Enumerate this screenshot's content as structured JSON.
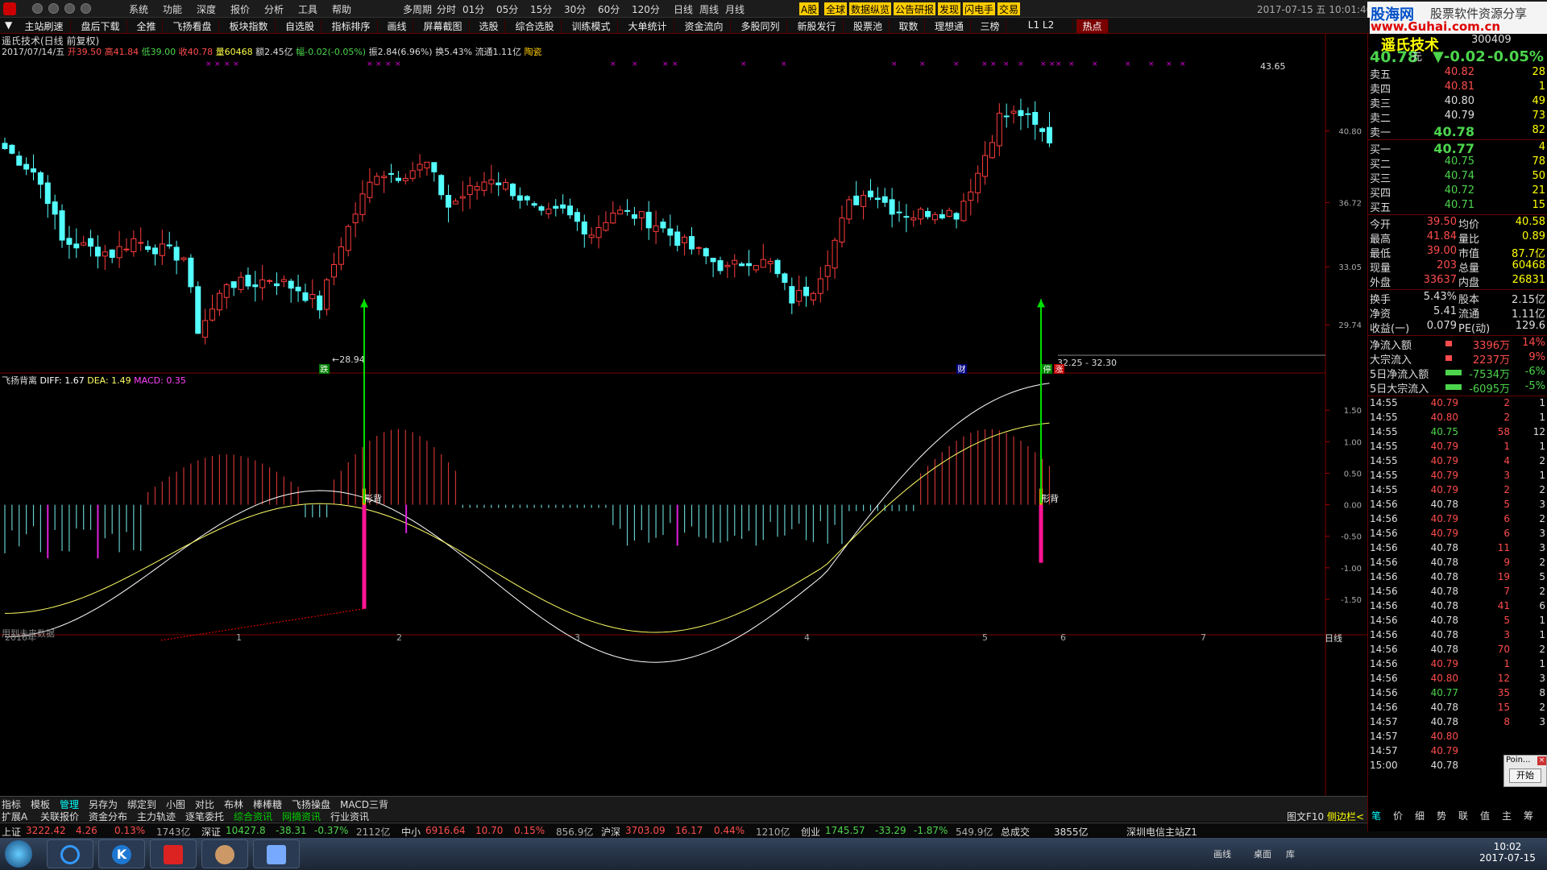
{
  "menu": [
    "系统",
    "功能",
    "深度",
    "报价",
    "分析",
    "工具",
    "帮助"
  ],
  "periods": [
    "多周期",
    "分时",
    "01分",
    "05分",
    "15分",
    "30分",
    "60分",
    "120分",
    "日线",
    "周线",
    "月线"
  ],
  "tags": [
    {
      "t": "A股",
      "c": "#ffcc00"
    },
    {
      "t": "全球",
      "c": "#ffcc00"
    },
    {
      "t": "数据纵览",
      "c": "#ffcc00"
    },
    {
      "t": "公告研报",
      "c": "#ffcc00"
    },
    {
      "t": "发现",
      "c": "#ffcc00"
    },
    {
      "t": "闪电手",
      "c": "#ffcc00"
    },
    {
      "t": "交易",
      "c": "#ffcc00"
    }
  ],
  "toolbar": [
    "主站刷速",
    "盘后下载",
    "全推",
    "飞扬看盘",
    "板块指数",
    "自选股",
    "指标排序",
    "画线",
    "屏幕截图",
    "选股",
    "综合选股",
    "训练模式",
    "大单统计",
    "资金流向",
    "多股同列",
    "新股发行",
    "股票池",
    "取数",
    "理想通",
    "三榜",
    "L1 L2",
    "热点"
  ],
  "datetime": "2017-07-15 五 10:01:46",
  "watermark": {
    "site": "股海网",
    "slogan": "股票软件资源分享",
    "url": "www.Guhai.com.cn"
  },
  "stock": {
    "name": "遥氏技术",
    "code": "300409",
    "price": "40.78",
    "unit": "元",
    "change": "▼-0.02",
    "pct": "-0.05%"
  },
  "chart_header": {
    "title": "遥氏技术(日线 前复权)",
    "date": "2017/07/14/五",
    "open": "开39.50",
    "high": "高41.84",
    "low": "低39.00",
    "close": "收40.78",
    "vol": "量60468",
    "amt": "额2.45亿",
    "rng": "幅-0.02(-0.05%)",
    "amp": "振2.84(6.96%)",
    "turn": "换5.43%",
    "flow": "流通1.11亿",
    "tag": "陶瓷"
  },
  "price_axis": [
    "40.80",
    "36.72",
    "33.05",
    "29.74"
  ],
  "price_labels": {
    "high": "43.65",
    "low": "←28.94",
    "zone": "32.25 - 32.30"
  },
  "markers": [
    {
      "t": "跌",
      "c": "#fff",
      "bg": "#008000"
    },
    {
      "t": "财",
      "c": "#fff",
      "bg": "#000080"
    },
    {
      "t": "停",
      "c": "#fff",
      "bg": "#008000"
    },
    {
      "t": "涨",
      "c": "#fff",
      "bg": "#c00000"
    }
  ],
  "macd_header": {
    "name": "飞扬背离",
    "diff": "DIFF: 1.67",
    "dea": "DEA: 1.49",
    "macd": "MACD: 0.35"
  },
  "macd_axis": [
    "1.50",
    "1.00",
    "0.50",
    "0.00",
    "-0.50",
    "-1.00",
    "-1.50"
  ],
  "div_label": "形背",
  "note": "用到未来数据",
  "xaxis": {
    "year": "2016年",
    "months": [
      "1",
      "2",
      "3",
      "4",
      "5",
      "6",
      "7"
    ],
    "period": "日线"
  },
  "tabs1": [
    "指标",
    "模板",
    "管理",
    "另存为",
    "绑定到",
    "小图",
    "对比",
    "布林",
    "棒棒糖",
    "飞扬操盘",
    "MACD三背"
  ],
  "tabs2": [
    "扩展A",
    "关联报价",
    "资金分布",
    "主力轨迹",
    "逐笔委托",
    "综合资讯",
    "网摘资讯",
    "行业资讯"
  ],
  "sells": [
    {
      "k": "卖五",
      "p": "40.82",
      "v": "28"
    },
    {
      "k": "卖四",
      "p": "40.81",
      "v": "1"
    },
    {
      "k": "卖三",
      "p": "40.80",
      "v": "49"
    },
    {
      "k": "卖二",
      "p": "40.79",
      "v": "73"
    },
    {
      "k": "卖一",
      "p": "40.78",
      "v": "82"
    }
  ],
  "buys": [
    {
      "k": "买一",
      "p": "40.77",
      "v": "4"
    },
    {
      "k": "买二",
      "p": "40.75",
      "v": "78"
    },
    {
      "k": "买三",
      "p": "40.74",
      "v": "50"
    },
    {
      "k": "买四",
      "p": "40.72",
      "v": "21"
    },
    {
      "k": "买五",
      "p": "40.71",
      "v": "15"
    }
  ],
  "stats": [
    [
      "今开",
      "39.50",
      "均价",
      "40.58"
    ],
    [
      "最高",
      "41.84",
      "量比",
      "0.89"
    ],
    [
      "最低",
      "39.00",
      "市值",
      "87.7亿"
    ],
    [
      "现量",
      "203",
      "总量",
      "60468"
    ],
    [
      "外盘",
      "33637",
      "内盘",
      "26831"
    ]
  ],
  "stats2": [
    [
      "换手",
      "5.43%",
      "股本",
      "2.15亿"
    ],
    [
      "净资",
      "5.41",
      "流通",
      "1.11亿"
    ],
    [
      "收益(一)",
      "0.079",
      "PE(动)",
      "129.6"
    ]
  ],
  "flows": [
    {
      "k": "净流入额",
      "v": "3396万",
      "p": "14%"
    },
    {
      "k": "大宗流入",
      "v": "2237万",
      "p": "9%"
    },
    {
      "k": "5日净流入额",
      "v": "-7534万",
      "p": "-6%"
    },
    {
      "k": "5日大宗流入",
      "v": "-6095万",
      "p": "-5%"
    }
  ],
  "ticks": [
    [
      "14:55",
      "40.79",
      "2",
      "1"
    ],
    [
      "14:55",
      "40.80",
      "2",
      "1"
    ],
    [
      "14:55",
      "40.75",
      "58",
      "12"
    ],
    [
      "14:55",
      "40.79",
      "1",
      "1"
    ],
    [
      "14:55",
      "40.79",
      "4",
      "2"
    ],
    [
      "14:55",
      "40.79",
      "3",
      "1"
    ],
    [
      "14:55",
      "40.79",
      "2",
      "2"
    ],
    [
      "14:56",
      "40.78",
      "5",
      "3"
    ],
    [
      "14:56",
      "40.79",
      "6",
      "2"
    ],
    [
      "14:56",
      "40.79",
      "6",
      "3"
    ],
    [
      "14:56",
      "40.78",
      "11",
      "3"
    ],
    [
      "14:56",
      "40.78",
      "9",
      "2"
    ],
    [
      "14:56",
      "40.78",
      "19",
      "5"
    ],
    [
      "14:56",
      "40.78",
      "7",
      "2"
    ],
    [
      "14:56",
      "40.78",
      "41",
      "6"
    ],
    [
      "14:56",
      "40.78",
      "5",
      "1"
    ],
    [
      "14:56",
      "40.78",
      "3",
      "1"
    ],
    [
      "14:56",
      "40.78",
      "70",
      "2"
    ],
    [
      "14:56",
      "40.79",
      "1",
      "1"
    ],
    [
      "14:56",
      "40.80",
      "12",
      "3"
    ],
    [
      "14:56",
      "40.77",
      "35",
      "8"
    ],
    [
      "14:56",
      "40.78",
      "15",
      "2"
    ],
    [
      "14:57",
      "40.78",
      "8",
      "3"
    ],
    [
      "14:57",
      "40.80",
      "",
      ""
    ],
    [
      "14:57",
      "40.79",
      "",
      ""
    ],
    [
      "15:00",
      "40.78",
      "",
      ""
    ]
  ],
  "rp_tabs": [
    "笔",
    "价",
    "细",
    "势",
    "联",
    "值",
    "主",
    "筹"
  ],
  "pointer": {
    "title": "Poin...",
    "btn": "开始"
  },
  "status": [
    {
      "k": "上证",
      "v": "3222.42",
      "c": "4.26",
      "p": "0.13%",
      "a": "1743亿"
    },
    {
      "k": "深证",
      "v": "10427.8",
      "c": "-38.31",
      "p": "-0.37%",
      "a": "2112亿"
    },
    {
      "k": "中小",
      "v": "6916.64",
      "c": "10.70",
      "p": "0.15%",
      "a": "856.9亿"
    },
    {
      "k": "沪深",
      "v": "3703.09",
      "c": "16.17",
      "p": "0.44%",
      "a": "1210亿"
    },
    {
      "k": "创业",
      "v": "1745.57",
      "c": "-33.29",
      "p": "-1.87%",
      "a": "549.9亿"
    }
  ],
  "status_extra": [
    "总成交",
    "3855亿",
    "深圳电信主站Z1"
  ],
  "bottom_right": [
    "图文F10",
    "侧边栏<"
  ],
  "taskbar": {
    "time": "10:02",
    "date": "2017-07-15",
    "items": [
      "画线",
      "桌面",
      "库"
    ]
  },
  "colors": {
    "up": "#ff3c3c",
    "down": "#54ffff",
    "grid": "#600",
    "diff": "#ffffff",
    "dea": "#ffff66"
  }
}
